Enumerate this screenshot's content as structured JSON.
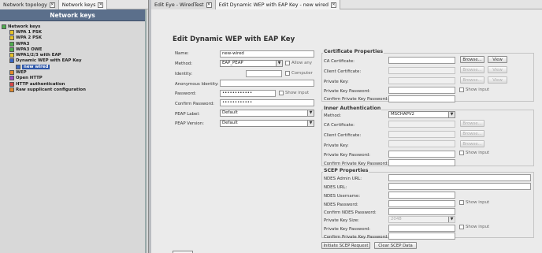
{
  "left_tabs": [
    {
      "label": "Network topology"
    },
    {
      "label": "Network keys"
    }
  ],
  "right_tabs": [
    {
      "label": "Edit Eye - WiredTest"
    },
    {
      "label": "Edit Dynamic WEP with EAP Key - new wired"
    }
  ],
  "close_glyph": "✕",
  "panel": {
    "title": "Network keys",
    "tree": [
      {
        "label": "Network keys",
        "icon": "folder-icon"
      },
      {
        "label": "WPA 1 PSK",
        "icon": "key-icon"
      },
      {
        "label": "WPA 2 PSK",
        "icon": "key-icon"
      },
      {
        "label": "WPA3",
        "icon": "key-icon"
      },
      {
        "label": "WPA3 OWE",
        "icon": "key-icon"
      },
      {
        "label": "WPA1/2/3 with EAP",
        "icon": "key-icon"
      },
      {
        "label": "Dynamic WEP with EAP Key",
        "icon": "key-icon"
      },
      {
        "label": "new wired",
        "icon": "key-icon"
      },
      {
        "label": "WEP",
        "icon": "key-icon"
      },
      {
        "label": "Open HTTP",
        "icon": "key-icon"
      },
      {
        "label": "HTTP authentication",
        "icon": "key-icon"
      },
      {
        "label": "Raw supplicant configuration",
        "icon": "key-icon"
      }
    ]
  },
  "editor": {
    "title": "Edit Dynamic WEP with EAP Key",
    "name": {
      "label": "Name:",
      "value": "new-wired"
    },
    "method": {
      "label": "Method:",
      "value": "EAP_PEAP",
      "allow_any": "Allow any"
    },
    "identity": {
      "label": "Identity:",
      "value": "",
      "computer": "Computer"
    },
    "anon_identity": {
      "label": "Anonymous Identity:",
      "value": ""
    },
    "password": {
      "label": "Password:",
      "value": "••••••••••••",
      "show_input": "Show input"
    },
    "confirm_password": {
      "label": "Confirm Password:",
      "value": "••••••••••••"
    },
    "peap_label": {
      "label": "PEAP Label:",
      "value": "Default"
    },
    "peap_version": {
      "label": "PEAP Version:",
      "value": "Default"
    }
  },
  "cert": {
    "title": "Certificate Properties",
    "ca_cert": "CA Certificate:",
    "client_cert": "Client Certificate:",
    "private_key": "Private Key:",
    "private_key_password": "Private Key Password:",
    "confirm_private_key_password": "Confirm Private Key Password:",
    "browse": "Browse...",
    "view": "View",
    "show_input": "Show input"
  },
  "inner": {
    "title": "Inner Authentication",
    "method_label": "Method:",
    "method_value": "MSCHAPV2",
    "ca_cert": "CA Certificate:",
    "client_cert": "Client Certificate:",
    "private_key": "Private Key:",
    "private_key_password": "Private Key Password:",
    "confirm_private_key_password": "Confirm Private Key Password:",
    "browse": "Browse...",
    "show_input": "Show input"
  },
  "scep": {
    "title": "SCEP Properties",
    "ndes_admin_url": "NDES Admin URL:",
    "ndes_url": "NDES URL:",
    "ndes_username": "NDES Username:",
    "ndes_password": "NDES Password:",
    "confirm_ndes_password": "Confirm NDES Password:",
    "private_key_size": "Private Key Size:",
    "private_key_size_value": "2048",
    "private_key_password": "Private Key Password:",
    "confirm_private_key_password": "Confirm Private Key Password:",
    "show_input": "Show input",
    "initiate_button": "Initiate SCEP Request",
    "clear_button": "Clear SCEP Data"
  }
}
